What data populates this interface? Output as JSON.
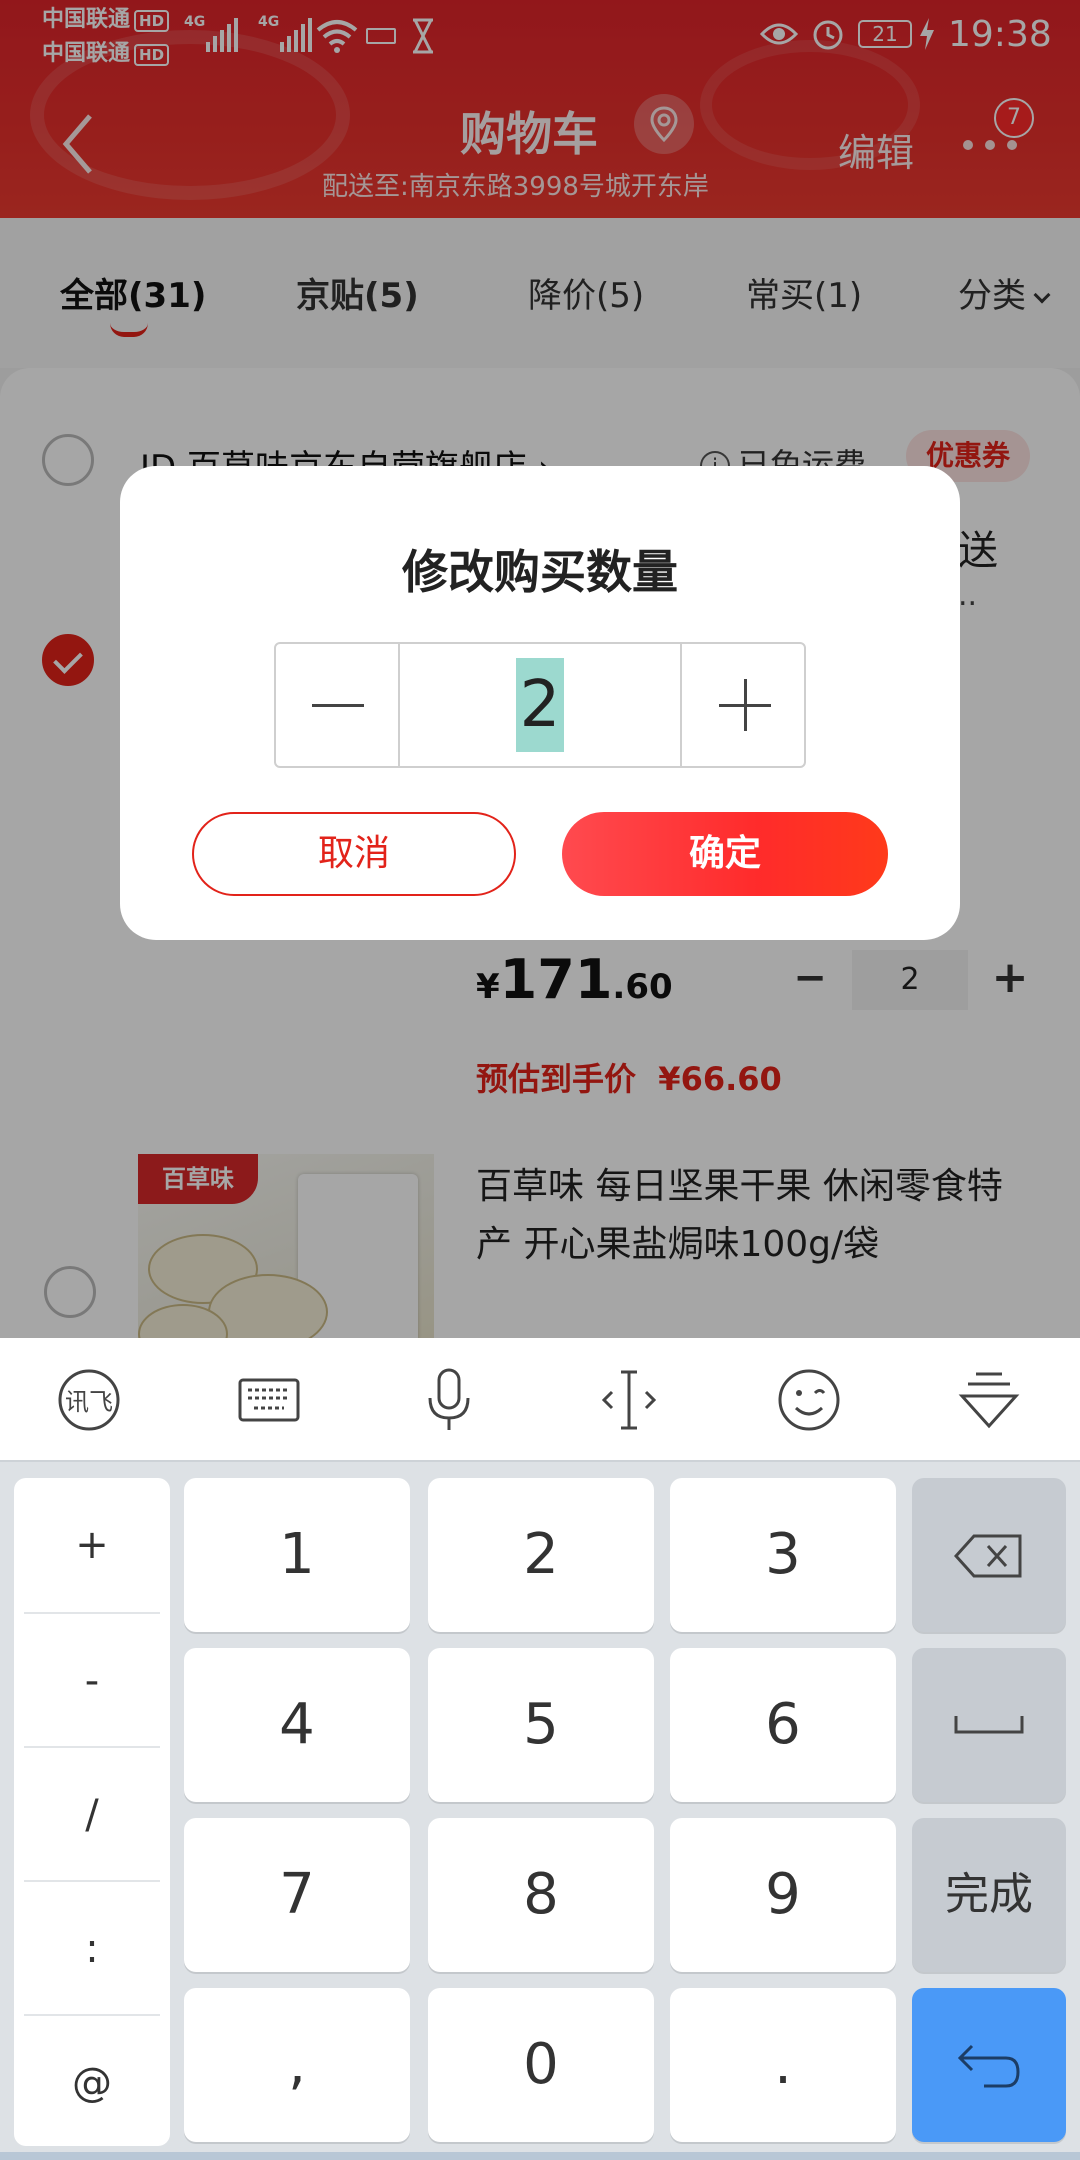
{
  "status_bar": {
    "carrier1": "中国联通",
    "carrier2": "中国联通",
    "hd": "HD",
    "net1": "4G",
    "net2": "4G",
    "battery": "21",
    "time": "19:38"
  },
  "header": {
    "title": "购物车",
    "subtitle": "配送至:南京东路3998号城开东岸",
    "edit_label": "编辑",
    "message_badge": "7"
  },
  "tabs": [
    {
      "label": "全部(31)",
      "active": true
    },
    {
      "label": "京贴(5)"
    },
    {
      "label": "降价(5)"
    },
    {
      "label": "常买(1)"
    },
    {
      "label": "分类"
    }
  ],
  "cart": {
    "shop_name": "JD 百草味京东自营旗舰店 ›",
    "free_shipping": "已免运费",
    "coupon": "优惠券",
    "partial_text_1": "送",
    "partial_text_2": "..",
    "item1": {
      "price_currency": "¥",
      "price_int": "171",
      "price_dec": ".60",
      "quantity": "2",
      "minus": "−",
      "plus": "+",
      "estimated_label": "预估到手价",
      "estimated_price": "¥66.60"
    },
    "item2": {
      "brand": "百草味",
      "name": "百草味 每日坚果干果 休闲零食特产 开心果盐焗味100g/袋"
    }
  },
  "dialog": {
    "title": "修改购买数量",
    "quantity": "2",
    "cancel_label": "取消",
    "confirm_label": "确定"
  },
  "keyboard": {
    "toolbar_icons": [
      "xunfei-icon",
      "keyboard-icon",
      "microphone-icon",
      "cursor-move-icon",
      "emoji-icon",
      "collapse-keyboard-icon"
    ],
    "xunfei_label": "讯飞",
    "side_keys": [
      "+",
      "-",
      "/",
      ":",
      "@"
    ],
    "keys": {
      "k1": "1",
      "k2": "2",
      "k3": "3",
      "k4": "4",
      "k5": "5",
      "k6": "6",
      "k7": "7",
      "k8": "8",
      "k9": "9",
      "comma": ",",
      "k0": "0",
      "dot": ".",
      "done": "完成"
    },
    "colors": {
      "enter": "#4a99f7",
      "accent": "#e2231a"
    }
  }
}
